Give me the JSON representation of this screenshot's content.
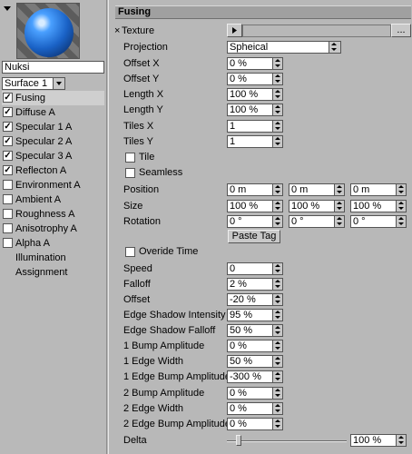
{
  "sidebar": {
    "material_name": "Nuksi",
    "surface": "Surface 1",
    "channels": [
      {
        "label": "Fusing",
        "checked": true
      },
      {
        "label": "Diffuse A",
        "checked": true
      },
      {
        "label": "Specular 1 A",
        "checked": true
      },
      {
        "label": "Specular 2 A",
        "checked": true
      },
      {
        "label": "Specular 3 A",
        "checked": true
      },
      {
        "label": "Reflecton A",
        "checked": true
      },
      {
        "label": "Environment A",
        "checked": false
      },
      {
        "label": "Ambient A",
        "checked": false
      },
      {
        "label": "Roughness A",
        "checked": false
      },
      {
        "label": "Anisotrophy A",
        "checked": false
      },
      {
        "label": "Alpha A",
        "checked": false
      }
    ],
    "extra_items": [
      "Illumination",
      "Assignment"
    ]
  },
  "panel": {
    "title": "Fusing",
    "texture": {
      "label": "Texture",
      "close_symbol": "×",
      "more_button": "..."
    },
    "projection": {
      "label": "Projection",
      "value": "Spheical"
    },
    "offset_x": {
      "label": "Offset X",
      "value": "0 %"
    },
    "offset_y": {
      "label": "Offset Y",
      "value": "0 %"
    },
    "length_x": {
      "label": "Length X",
      "value": "100 %"
    },
    "length_y": {
      "label": "Length Y",
      "value": "100 %"
    },
    "tiles_x": {
      "label": "Tiles X",
      "value": "1"
    },
    "tiles_y": {
      "label": "Tiles Y",
      "value": "1"
    },
    "tile": {
      "label": "Tile",
      "checked": false
    },
    "seamless": {
      "label": "Seamless",
      "checked": false
    },
    "position": {
      "label": "Position",
      "values": [
        "0 m",
        "0 m",
        "0 m"
      ]
    },
    "size": {
      "label": "Size",
      "values": [
        "100 %",
        "100 %",
        "100 %"
      ]
    },
    "rotation": {
      "label": "Rotation",
      "values": [
        "0 °",
        "0 °",
        "0 °"
      ]
    },
    "paste_tag": "Paste Tag",
    "override_time": {
      "label": "Overide Time",
      "checked": false
    },
    "speed": {
      "label": "Speed",
      "value": "0"
    },
    "falloff": {
      "label": "Falloff",
      "value": "2 %"
    },
    "offset": {
      "label": "Offset",
      "value": "-20 %"
    },
    "edge_shadow_intensity": {
      "label": "Edge Shadow Intensity",
      "value": "95 %"
    },
    "edge_shadow_falloff": {
      "label": "Edge Shadow Falloff",
      "value": "50 %"
    },
    "bump1_amplitude": {
      "label": "1 Bump Amplitude",
      "value": "0 %"
    },
    "edge1_width": {
      "label": "1 Edge Width",
      "value": "50 %"
    },
    "edge1_bump_amplitude": {
      "label": "1 Edge Bump Amplitude",
      "value": "-300 %"
    },
    "bump2_amplitude": {
      "label": "2 Bump Amplitude",
      "value": "0 %"
    },
    "edge2_width": {
      "label": "2 Edge Width",
      "value": "0 %"
    },
    "edge2_bump_amplitude": {
      "label": "2 Edge Bump Amplitude",
      "value": "0 %"
    },
    "delta": {
      "label": "Delta",
      "value": "100 %",
      "slider_fraction": 1.0
    }
  }
}
